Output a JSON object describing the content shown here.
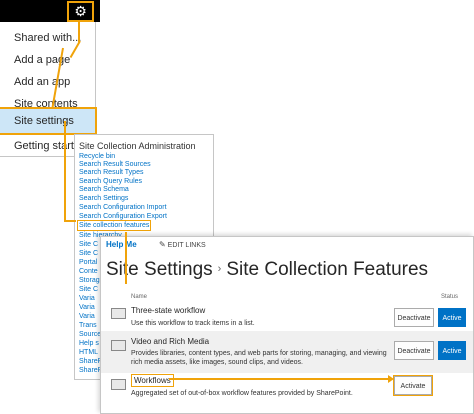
{
  "accent_color": "#f0a30a",
  "link_color": "#0072c6",
  "topbar": {
    "gear_icon": "gear-icon",
    "gear_glyph": "⚙"
  },
  "menu": {
    "items": [
      {
        "label": "Shared with..."
      },
      {
        "label": "Add a page"
      },
      {
        "label": "Add an app"
      },
      {
        "label": "Site contents"
      },
      {
        "label": "Site settings"
      },
      {
        "label": "Getting started"
      }
    ],
    "selected_index": 4
  },
  "admin": {
    "title": "Site Collection Administration",
    "links": [
      "Recycle bin",
      "Search Result Sources",
      "Search Result Types",
      "Search Query Rules",
      "Search Schema",
      "Search Settings",
      "Search Configuration Import",
      "Search Configuration Export",
      "Site collection features",
      "Site hierarchy",
      "Site C",
      "Site C",
      "Portal",
      "Conte",
      "Storag",
      "Site C",
      "Varia",
      "Varia",
      "Varia",
      "Trans",
      "Source",
      "Help s",
      "HTML",
      "ShareP",
      "SharePo"
    ],
    "highlighted_index": 8
  },
  "main": {
    "help_tab": "Help Me",
    "edit_links": "EDIT LINKS",
    "title_part1": "Site Settings",
    "title_sep": "›",
    "title_part2": "Site Collection Features",
    "col_name": "Name",
    "col_status": "Status",
    "features": [
      {
        "title": "Three-state workflow",
        "description": "Use this workflow to track items in a list.",
        "action": "Deactivate",
        "status": "Active"
      },
      {
        "title": "Video and Rich Media",
        "description": "Provides libraries, content types, and web parts for storing, managing, and viewing rich media assets, like images, sound clips, and videos.",
        "action": "Deactivate",
        "status": "Active"
      },
      {
        "title": "Workflows",
        "description": "Aggregated set of out-of-box workflow features provided by SharePoint.",
        "action": "Activate",
        "status": ""
      }
    ]
  }
}
